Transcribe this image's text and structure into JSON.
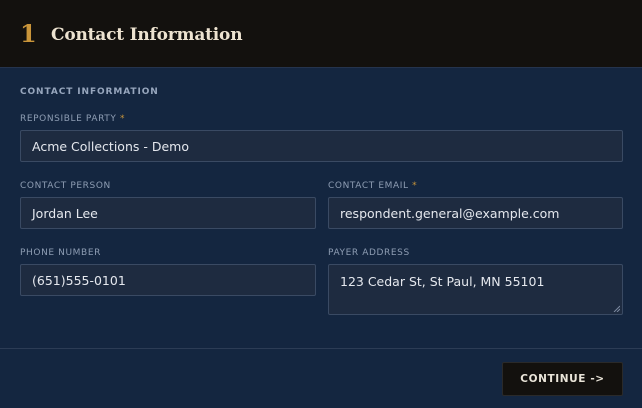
{
  "header": {
    "step_number": "1",
    "title": "Contact Information"
  },
  "section": {
    "label": "CONTACT INFORMATION"
  },
  "fields": {
    "responsible_party": {
      "label": "REPONSIBLE PARTY",
      "required_marker": "*",
      "value": "Acme Collections - Demo"
    },
    "contact_person": {
      "label": "CONTACT PERSON",
      "value": "Jordan Lee"
    },
    "contact_email": {
      "label": "CONTACT EMAIL",
      "required_marker": "*",
      "value": "respondent.general@example.com"
    },
    "phone_number": {
      "label": "PHONE NUMBER",
      "value": "(651)555-0101"
    },
    "payer_address": {
      "label": "PAYER ADDRESS",
      "value": "123 Cedar St, St Paul, MN 55101"
    }
  },
  "footer": {
    "continue_label": "CONTINUE ->"
  },
  "colors": {
    "header_bg": "#13110e",
    "page_bg": "#142640",
    "field_bg": "#1e2b40",
    "accent": "#c9953a",
    "title_text": "#ede3d0"
  }
}
